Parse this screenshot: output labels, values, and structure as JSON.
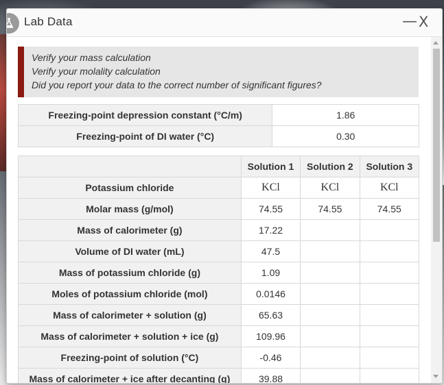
{
  "window": {
    "title": "Lab Data",
    "minimize_label": "—",
    "close_label": "X"
  },
  "notice": {
    "lines": [
      "Verify your mass calculation",
      "Verify your molality calculation",
      "Did you report your data to the correct number of significant figures?"
    ]
  },
  "constants": [
    {
      "label": "Freezing-point depression constant (°C/m)",
      "value": "1.86"
    },
    {
      "label": "Freezing-point of DI water (°C)",
      "value": "0.30"
    }
  ],
  "data_table": {
    "headers": [
      "",
      "Solution 1",
      "Solution 2",
      "Solution 3"
    ],
    "rows": [
      {
        "label": "Potassium chloride",
        "values": [
          "KCl",
          "KCl",
          "KCl"
        ]
      },
      {
        "label": "Molar mass (g/mol)",
        "values": [
          "74.55",
          "74.55",
          "74.55"
        ]
      },
      {
        "label": "Mass of calorimeter (g)",
        "values": [
          "17.22",
          "",
          ""
        ]
      },
      {
        "label": "Volume of DI water (mL)",
        "values": [
          "47.5",
          "",
          ""
        ]
      },
      {
        "label": "Mass of potassium chloride (g)",
        "values": [
          "1.09",
          "",
          ""
        ]
      },
      {
        "label": "Moles of potassium chloride (mol)",
        "values": [
          "0.0146",
          "",
          ""
        ]
      },
      {
        "label": "Mass of calorimeter + solution (g)",
        "values": [
          "65.63",
          "",
          ""
        ]
      },
      {
        "label": "Mass of calorimeter + solution + ice (g)",
        "values": [
          "109.96",
          "",
          ""
        ]
      },
      {
        "label": "Freezing-point of solution (°C)",
        "values": [
          "-0.46",
          "",
          ""
        ]
      },
      {
        "label": "Mass of calorimeter + ice after decanting (g)",
        "values": [
          "39.88",
          "",
          ""
        ]
      }
    ]
  },
  "colors": {
    "notice_accent": "#8b1a12",
    "label_cell_bg": "#f1f1f1",
    "grid": "#d8d8d8"
  },
  "icons": {
    "title_icon": "flask-icon"
  }
}
